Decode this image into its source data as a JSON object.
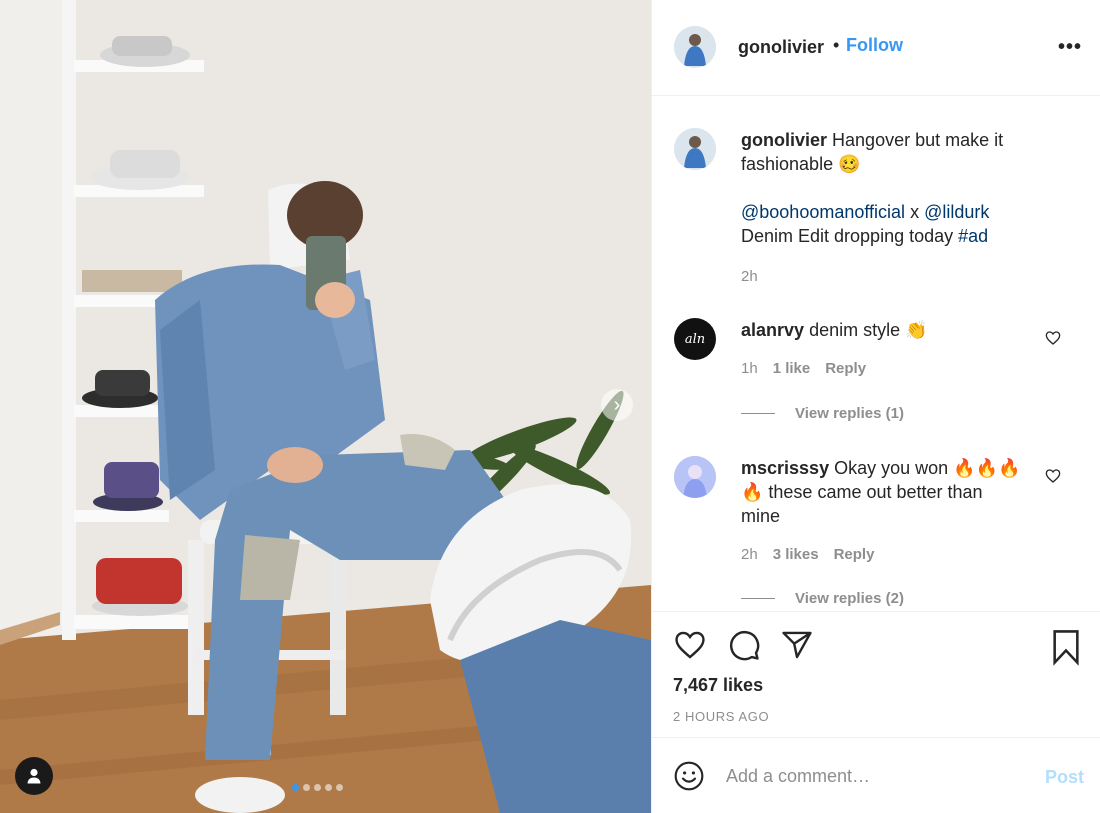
{
  "post": {
    "username": "gonolivier",
    "separator": "•",
    "follow_label": "Follow",
    "more_label": "•••",
    "caption_line1": "Hangover but make it",
    "caption_line2": "fashionable 🥴",
    "mention1": "@boohoomanofficial",
    "caption_x": " x ",
    "mention2": "@lildurk",
    "caption_line4": "Denim Edit dropping today ",
    "hashtag": "#ad",
    "caption_time": "2h",
    "photo_count": 5,
    "photo_index": 1
  },
  "comments": [
    {
      "username": "alanrvy",
      "avatar_text": "aln",
      "line1": "denim style 👏",
      "time": "1h",
      "likes": "1 like",
      "reply_label": "Reply",
      "replies_label": "View replies (1)"
    },
    {
      "username": "mscrisssy",
      "line1": "Okay you won 🔥🔥🔥",
      "line2": "🔥 these came out better than",
      "line3": "mine",
      "time": "2h",
      "likes": "3 likes",
      "reply_label": "Reply",
      "replies_label": "View replies (2)"
    }
  ],
  "actions": {
    "likes_count": "7,467 likes",
    "time_ago": "2 HOURS AGO"
  },
  "comment_box": {
    "placeholder": "Add a comment…",
    "post_label": "Post"
  },
  "colors": {
    "accent": "#3897f0",
    "link": "#00376b",
    "muted": "#8e8e8e",
    "post_disabled": "#b2dffc"
  }
}
